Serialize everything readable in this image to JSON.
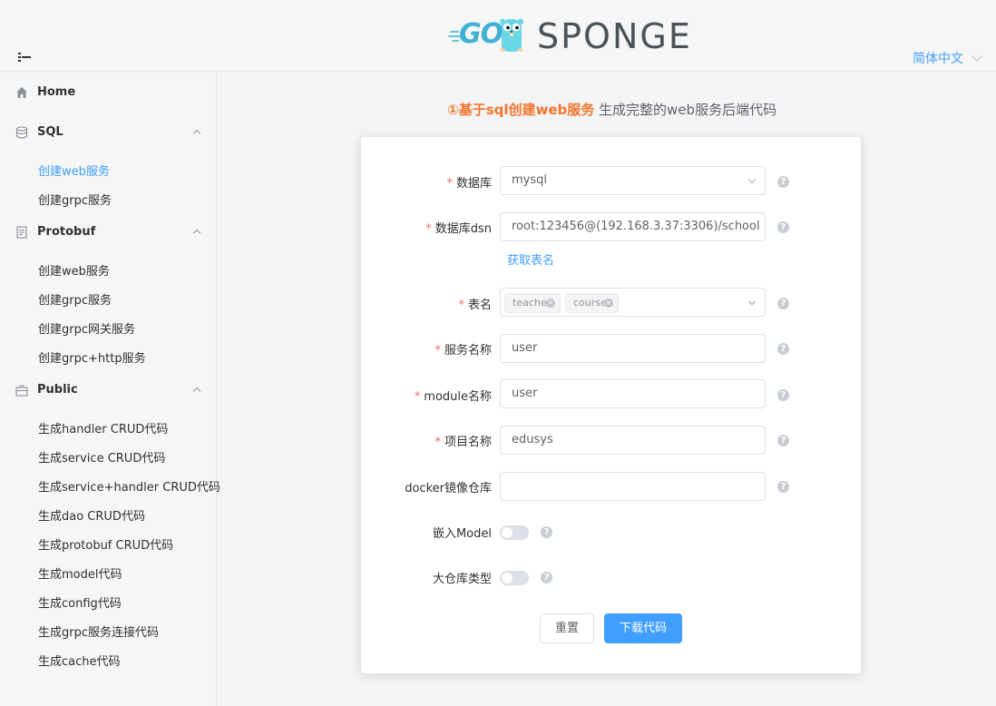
{
  "header": {
    "logo_go": "GO",
    "logo_sponge": "SPONGE",
    "language": "简体中文"
  },
  "sidebar": {
    "groups": [
      {
        "label": "Home",
        "icon": "home-icon",
        "items": []
      },
      {
        "label": "SQL",
        "icon": "database-icon",
        "items": [
          "创建web服务",
          "创建grpc服务"
        ]
      },
      {
        "label": "Protobuf",
        "icon": "document-icon",
        "items": [
          "创建web服务",
          "创建grpc服务",
          "创建grpc网关服务",
          "创建grpc+http服务"
        ]
      },
      {
        "label": "Public",
        "icon": "briefcase-icon",
        "items": [
          "生成handler CRUD代码",
          "生成service CRUD代码",
          "生成service+handler CRUD代码",
          "生成dao CRUD代码",
          "生成protobuf CRUD代码",
          "生成model代码",
          "生成config代码",
          "生成grpc服务连接代码",
          "生成cache代码"
        ]
      }
    ],
    "active_item": "创建web服务"
  },
  "main": {
    "headline_highlight": "①基于sql创建web服务",
    "headline_rest": " 生成完整的web服务后端代码",
    "form": {
      "database_label": "数据库",
      "database_value": "mysql",
      "dsn_label": "数据库dsn",
      "dsn_value": "root:123456@(192.168.3.37:3306)/school",
      "fetch_tables_link": "获取表名",
      "tables_label": "表名",
      "tables": [
        "teacher",
        "course"
      ],
      "service_label": "服务名称",
      "service_value": "user",
      "module_label": "module名称",
      "module_value": "user",
      "project_label": "项目名称",
      "project_value": "edusys",
      "docker_label": "docker镜像仓库",
      "docker_value": "",
      "embed_label": "嵌入Model",
      "embed_on": false,
      "monorepo_label": "大仓库类型",
      "monorepo_on": false,
      "help_symbol": "?",
      "required_mark": "*"
    },
    "buttons": {
      "reset": "重置",
      "download": "下载代码"
    }
  },
  "colors": {
    "accent": "#409eff",
    "highlight": "#f5742b",
    "required": "#f56c6c"
  }
}
